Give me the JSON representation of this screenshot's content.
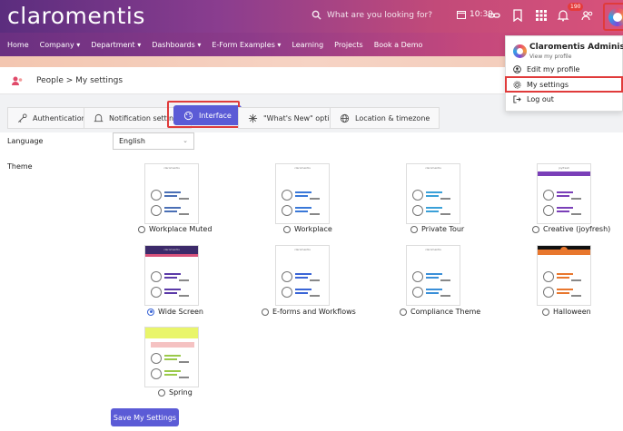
{
  "app": {
    "logo_text": "claromentis"
  },
  "search": {
    "placeholder": "What are you looking for?"
  },
  "header": {
    "time": "10:39",
    "notification_count": "190"
  },
  "nav": {
    "items": [
      "Home",
      "Company ▾",
      "Department ▾",
      "Dashboards ▾",
      "E-Form Examples ▾",
      "Learning",
      "Projects",
      "Book a Demo"
    ]
  },
  "breadcrumb": {
    "text": "People > My settings"
  },
  "tabs": [
    {
      "label": "Authentication"
    },
    {
      "label": "Notification settings"
    },
    {
      "label": "Interface"
    },
    {
      "label": "\"What's New\" options"
    },
    {
      "label": "Location & timezone"
    }
  ],
  "form": {
    "language_label": "Language",
    "language_value": "English",
    "theme_label": "Theme",
    "save_label": "Save My Settings"
  },
  "themes": [
    {
      "label": "Workplace Muted",
      "header_text": "claromentis",
      "selected": false,
      "accent": "#4a6fb5"
    },
    {
      "label": "Workplace",
      "header_text": "claromentis",
      "selected": false,
      "accent": "#3a78d8"
    },
    {
      "label": "Private Tour",
      "header_text": "claromentis",
      "selected": false,
      "accent": "#3aa0d8"
    },
    {
      "label": "Creative (joyfresh)",
      "header_text": "joyfresh",
      "selected": false,
      "accent": "#7a3fb8"
    },
    {
      "label": "Wide Screen",
      "header_text": "claromentis",
      "selected": true,
      "accent": "#5b3aa8"
    },
    {
      "label": "E-forms and Workflows",
      "header_text": "claromentis",
      "selected": false,
      "accent": "#3a65d6"
    },
    {
      "label": "Compliance Theme",
      "header_text": "claromentis",
      "selected": false,
      "accent": "#3a8fd8"
    },
    {
      "label": "Halloween",
      "header_text": "",
      "selected": false,
      "accent": "#e8772e"
    },
    {
      "label": "Spring",
      "header_text": "",
      "selected": false,
      "accent": "#9ac94a"
    }
  ],
  "user_menu": {
    "name": "Claromentis Administrator",
    "view_profile": "View my profile",
    "items": [
      "Edit my profile",
      "My settings",
      "Log out"
    ]
  }
}
